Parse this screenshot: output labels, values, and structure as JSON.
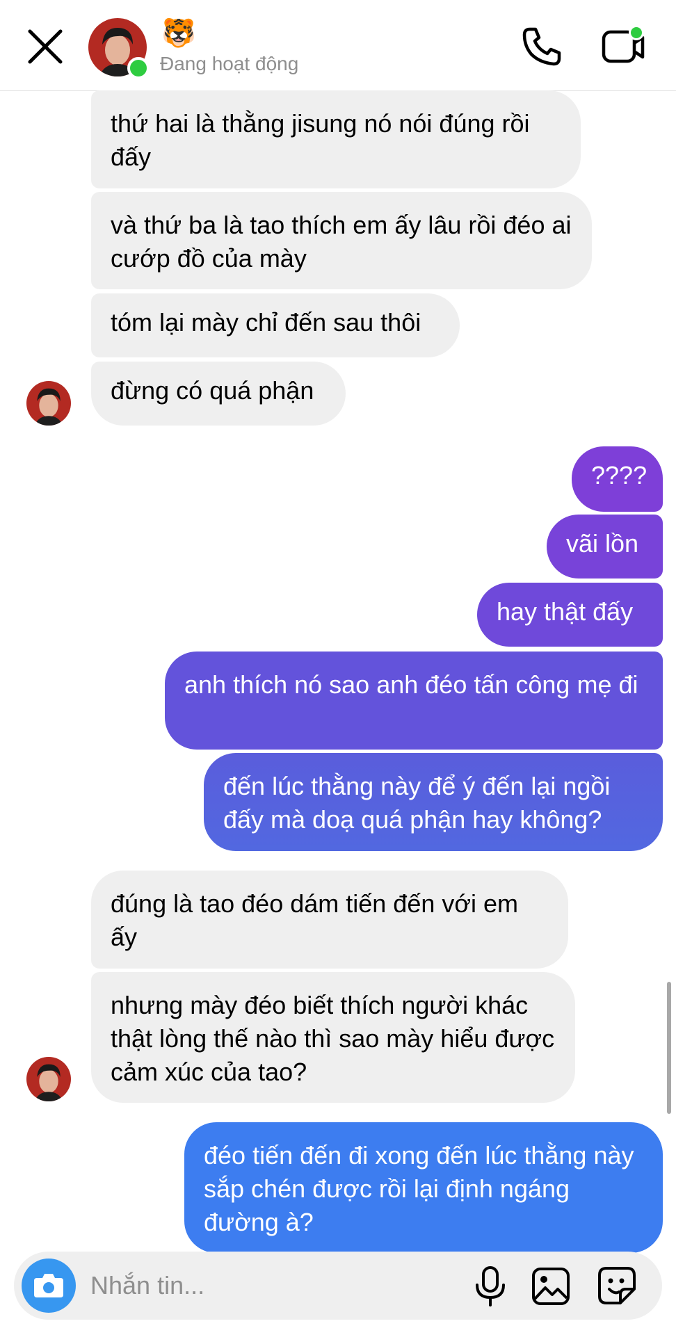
{
  "header": {
    "contact_name_emoji": "🐯",
    "status": "Đang hoạt động"
  },
  "messages": [
    {
      "side": "in",
      "text": "thứ hai là thằng jisung nó nói đúng rồi đấy"
    },
    {
      "side": "in",
      "text": "và thứ ba là tao thích em ấy lâu rồi đéo ai cướp đồ của mày"
    },
    {
      "side": "in",
      "text": "tóm lại mày chỉ đến sau thôi"
    },
    {
      "side": "in",
      "text": "đừng có quá phận"
    },
    {
      "side": "out",
      "text": "????"
    },
    {
      "side": "out",
      "text": "vãi lồn"
    },
    {
      "side": "out",
      "text": "hay thật đấy"
    },
    {
      "side": "out",
      "text": "anh thích nó sao anh đéo tấn công mẹ đi"
    },
    {
      "side": "out",
      "text": "đến lúc thằng này để ý đến lại ngồi đấy mà doạ quá phận hay không?"
    },
    {
      "side": "in",
      "text": "đúng là tao đéo dám tiến đến với em ấy"
    },
    {
      "side": "in",
      "text": "nhưng mày đéo biết thích người khác thật lòng thế nào thì sao mày hiểu được cảm xúc của tao?"
    },
    {
      "side": "out",
      "text": "đéo tiến đến đi xong đến lúc thằng này sắp chén được rồi lại định ngáng đường à?"
    }
  ],
  "composer": {
    "placeholder": "Nhắn tin..."
  },
  "colors": {
    "incoming_bubble": "#efefef",
    "outgoing_gradient_top": "#7b3fd6",
    "outgoing_gradient_bottom": "#3d7df0",
    "online": "#2ecc40",
    "camera_button": "#3797f0",
    "status_text": "#8e8e8e"
  },
  "icons": {
    "close": "close-icon",
    "call": "phone-icon",
    "video": "video-camera-icon",
    "camera": "camera-icon",
    "mic": "microphone-icon",
    "gallery": "gallery-icon",
    "sticker": "sticker-icon"
  }
}
